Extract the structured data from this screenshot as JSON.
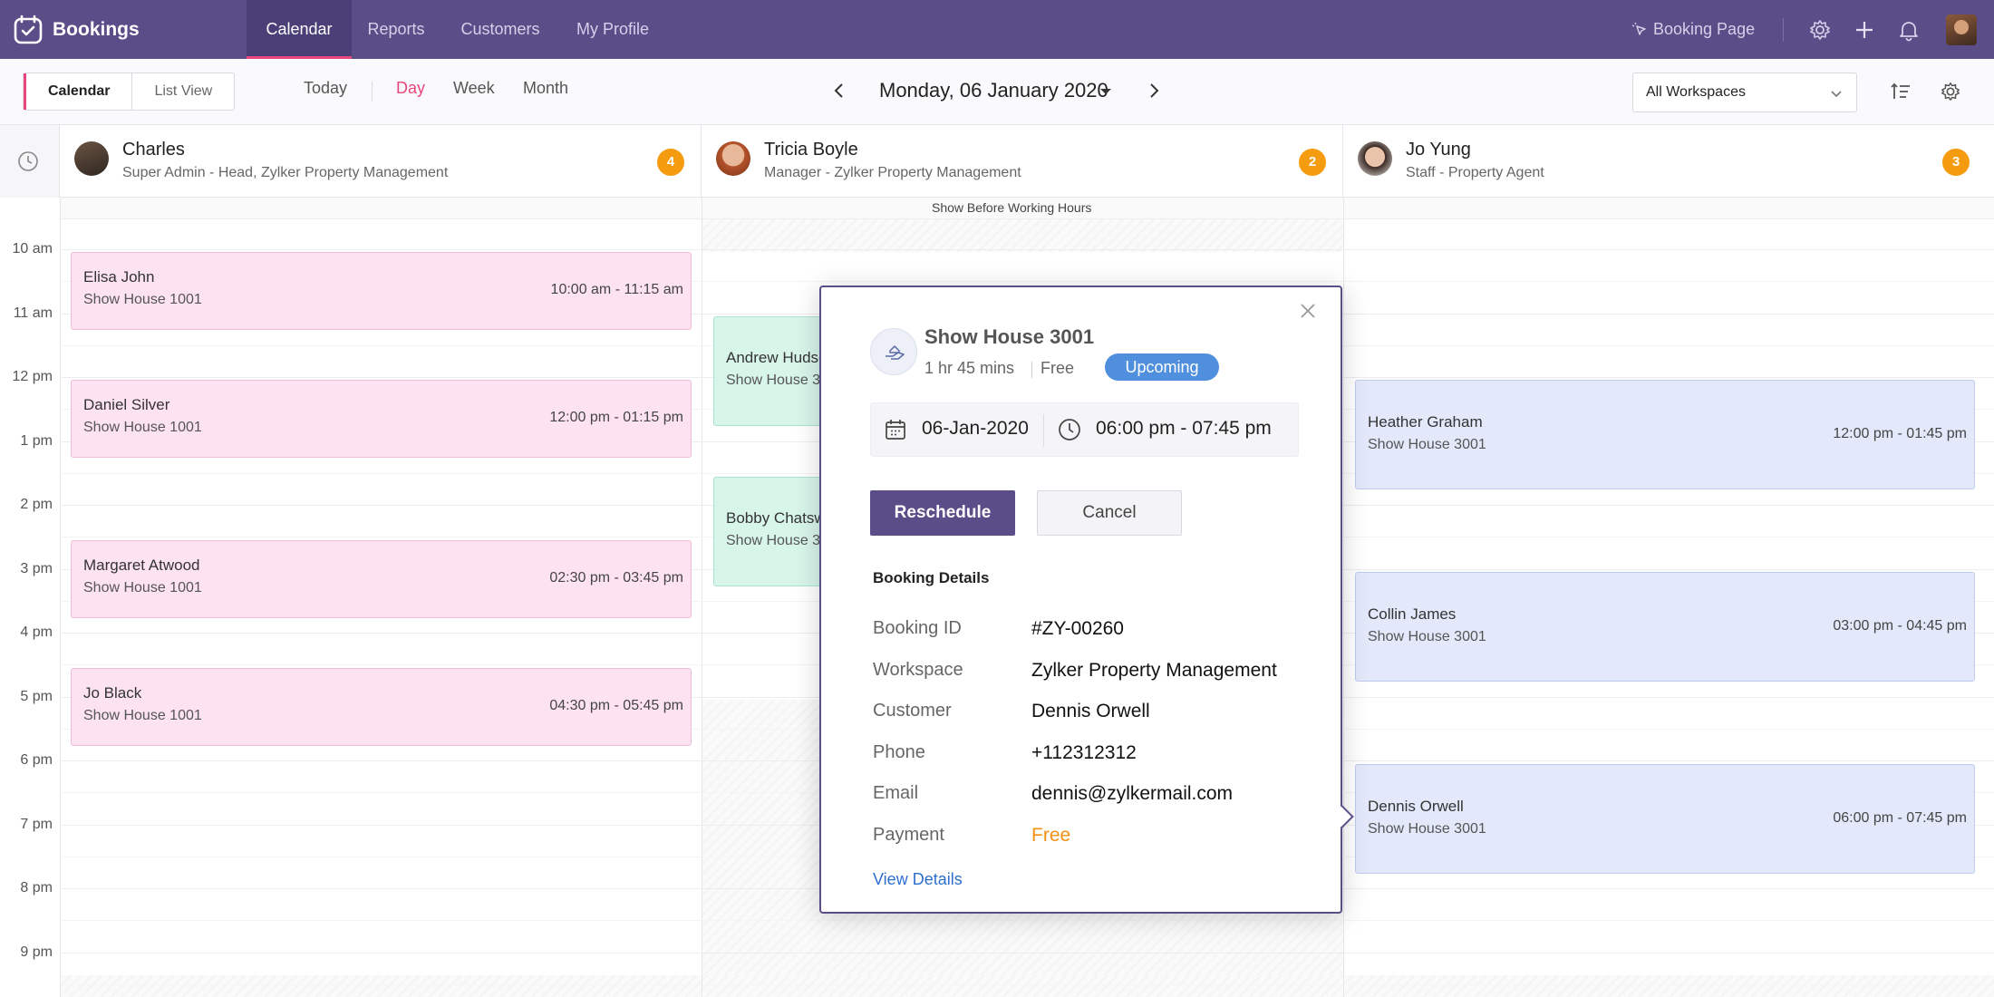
{
  "app": {
    "name": "Bookings"
  },
  "nav": [
    {
      "label": "Calendar",
      "active": true
    },
    {
      "label": "Reports"
    },
    {
      "label": "Customers"
    },
    {
      "label": "My Profile"
    }
  ],
  "top_right": {
    "booking_page": "Booking Page",
    "icons": [
      "gear-icon",
      "plus-icon",
      "bell-icon",
      "avatar"
    ]
  },
  "toolbar": {
    "view_toggle": [
      "Calendar",
      "List View"
    ],
    "today": "Today",
    "ranges": [
      "Day",
      "Week",
      "Month"
    ],
    "active_range": "Day",
    "date": "Monday, 06 January 2020",
    "workspace": "All Workspaces"
  },
  "staff": [
    {
      "name": "Charles",
      "role": "Super Admin - Head, Zylker Property Management",
      "count": "4"
    },
    {
      "name": "Tricia Boyle",
      "role": "Manager - Zylker Property Management",
      "count": "2"
    },
    {
      "name": "Jo Yung",
      "role": "Staff - Property Agent",
      "count": "3"
    }
  ],
  "grid": {
    "before_hours": "Show Before Working Hours",
    "hours": [
      "10 am",
      "11 am",
      "12 pm",
      "1 pm",
      "2 pm",
      "3 pm",
      "4 pm",
      "5 pm",
      "6 pm",
      "7 pm",
      "8 pm",
      "9 pm"
    ]
  },
  "bookings": {
    "charles": [
      {
        "name": "Elisa John",
        "service": "Show House 1001",
        "time": "10:00 am - 11:15 am"
      },
      {
        "name": "Daniel Silver",
        "service": "Show House 1001",
        "time": "12:00 pm - 01:15 pm"
      },
      {
        "name": "Margaret Atwood",
        "service": "Show House 1001",
        "time": "02:30 pm - 03:45 pm"
      },
      {
        "name": "Jo Black",
        "service": "Show House 1001",
        "time": "04:30 pm - 05:45 pm"
      }
    ],
    "tricia": [
      {
        "name": "Andrew Hudson",
        "service": "Show House 3001"
      },
      {
        "name": "Bobby Chatsworth",
        "service": "Show House 3001"
      }
    ],
    "jo": [
      {
        "name": "Heather Graham",
        "service": "Show House 3001",
        "time": "12:00 pm - 01:45 pm"
      },
      {
        "name": "Collin James",
        "service": "Show House 3001",
        "time": "03:00 pm - 04:45 pm"
      },
      {
        "name": "Dennis Orwell",
        "service": "Show House 3001",
        "time": "06:00 pm - 07:45 pm"
      }
    ]
  },
  "popup": {
    "service": "Show House 3001",
    "duration": "1 hr 45 mins",
    "price": "Free",
    "status": "Upcoming",
    "date": "06-Jan-2020",
    "time": "06:00 pm - 07:45 pm",
    "reschedule": "Reschedule",
    "cancel": "Cancel",
    "details_title": "Booking Details",
    "details": [
      {
        "key": "Booking ID",
        "value": "#ZY-00260"
      },
      {
        "key": "Workspace",
        "value": "Zylker Property Management"
      },
      {
        "key": "Customer",
        "value": "Dennis Orwell"
      },
      {
        "key": "Phone",
        "value": "+112312312"
      },
      {
        "key": "Email",
        "value": "dennis@zylkermail.com"
      },
      {
        "key": "Payment",
        "value": "Free"
      }
    ],
    "view_details": "View Details"
  },
  "colors": {
    "primary": "#5a4d88",
    "accent": "#e8467c",
    "badge": "#f59b0f",
    "status": "#4f8fdd",
    "free": "#f39014"
  }
}
